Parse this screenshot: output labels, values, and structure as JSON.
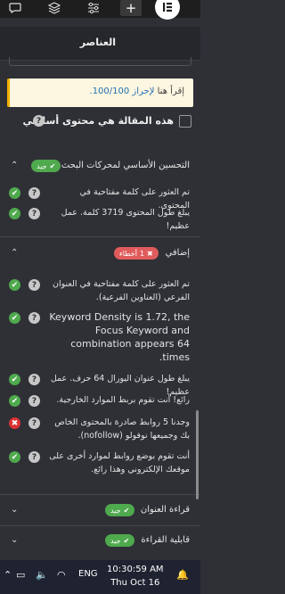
{
  "toolbar": {
    "icons": [
      "comment-icon",
      "layers-icon",
      "sliders-icon",
      "plus-icon",
      "elementor-logo-icon"
    ],
    "plus_label": "+"
  },
  "panel": {
    "title": "العناصر"
  },
  "notice": {
    "prefix": "إقرأ هنا",
    "link": "لإحراز 100/100."
  },
  "cornerstone": {
    "label": "هذه المقالة هي محتوى أساسي"
  },
  "sections": {
    "seo": {
      "title": "التحسين الأساسي لمحركات البحث",
      "badge": "جيد",
      "results": [
        {
          "status": "good",
          "text": "تم العثور على كلمة مفتاحية في المحتوى."
        },
        {
          "status": "good",
          "text": "يبلغ طول المحتوى 3719 كلمة. عمل عظيم!"
        }
      ]
    },
    "additional": {
      "title": "إضافي",
      "badge_count": "1",
      "badge_label": "أخطاء",
      "results": [
        {
          "status": "good",
          "text": "تم العثور على كلمة مفتاحية في العنوان الفرعي (العناوين الفرعية)."
        },
        {
          "status": "good",
          "text": "Keyword Density is 1.72, the Focus Keyword and combination appears 64 times.",
          "big": true
        },
        {
          "status": "good",
          "text": "يبلغ طول عنوان اليورال 64 حرف. عمل عظيم!"
        },
        {
          "status": "good",
          "text": "رائع! أنت تقوم بربط الموارد الخارجية."
        },
        {
          "status": "bad",
          "text": "وجدنا 5 روابط صادرة بالمحتوى الخاص بك وجميعها نوفولو (nofollow)."
        },
        {
          "status": "good",
          "text": "أنت تقوم بوضع روابط لموارد أخرى على موقعك الإلكتروني وهذا رائع."
        }
      ]
    },
    "title_readability": {
      "title": "قراءة العنوان",
      "badge": "جيد"
    },
    "content_readability": {
      "title": "قابلية القراءة",
      "badge": "جيد"
    }
  },
  "taskbar": {
    "lang": "ENG",
    "time": "10:30:59 AM",
    "date": "Thu Oct 16"
  }
}
